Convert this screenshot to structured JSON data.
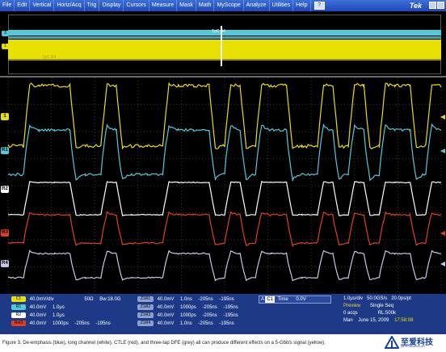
{
  "menu": {
    "items": [
      "File",
      "Edit",
      "Vertical",
      "Horiz/Acq",
      "Trig",
      "Display",
      "Cursors",
      "Measure",
      "Mask",
      "Math",
      "MyScope",
      "Analyze",
      "Utilities",
      "Help"
    ],
    "help_icon": "question-mark",
    "brand": "Tek"
  },
  "record_strip": {
    "zoom_label": "TpC B4",
    "channel_label": "TpC R4",
    "colors": {
      "ch1": "#e8e000",
      "ch2": "#55c8d8"
    }
  },
  "markers": {
    "strip": [
      {
        "label": "3",
        "color": "#55c8d8"
      },
      {
        "label": "1",
        "color": "#e8e000"
      }
    ],
    "main": [
      {
        "label": "1",
        "color": "#e8e000"
      },
      {
        "label": "R1",
        "color": "#55c8d8"
      },
      {
        "label": "R2",
        "color": "#ffffff"
      },
      {
        "label": "R3",
        "color": "#e04020"
      },
      {
        "label": "R4",
        "color": "#c8c8e8"
      }
    ]
  },
  "readouts": {
    "rows": [
      {
        "chip": "C1",
        "chip_color": "#e8e000",
        "values": [
          "40.0mV/div",
          "50Ω",
          "Bw:18.0G"
        ]
      },
      {
        "chip": "R1",
        "chip_color": "#55c8d8",
        "values": [
          "40.0mV",
          "1.0μs"
        ]
      },
      {
        "chip": "R2",
        "chip_color": "#ffffff",
        "values": [
          "40.0mV",
          "1.0μs"
        ]
      },
      {
        "chip": "Ref3",
        "chip_color": "#e04020",
        "values": [
          "40.0mV",
          "1000ps",
          "-205ns",
          "-195ns"
        ]
      }
    ],
    "zoom_rows": [
      {
        "chip": "Z1R1",
        "values": [
          "40.0mV",
          "1.0ns",
          "-205ns",
          "-195ns"
        ]
      },
      {
        "chip": "Z1R2",
        "values": [
          "40.0mV",
          "1000ps",
          "-205ns",
          "-195ns"
        ]
      },
      {
        "chip": "Z1R3",
        "values": [
          "40.0mV",
          "1000ps",
          "-205ns",
          "-195ns"
        ]
      },
      {
        "chip": "Z1R4",
        "values": [
          "40.0mV",
          "1.0ns",
          "-205ns",
          "-195ns"
        ]
      }
    ],
    "timebase": {
      "chip": "A",
      "source": "C1",
      "label": "Time",
      "value": "0.0V"
    },
    "acquisition": {
      "scale": "1.0μs/div",
      "sample_rate": "50.0GS/s",
      "resolution": "20.0ps/pt",
      "mode_label": "Preview",
      "mode": "Single Seq",
      "acqs": "0 acqs",
      "record_length": "RL:500k",
      "user": "Man",
      "date": "June 15, 2009",
      "time": "17:58:08"
    }
  },
  "caption": "Figure 3. De-emphasis (blue), long channel (white), CTLE (red), and three-tap DFE (grey) all can produce different effects on a 5-Gbit/s signal (yellow).",
  "watermark": {
    "text": "至爱科技",
    "sub": "ZHI AI TECHNOLOGY"
  }
}
